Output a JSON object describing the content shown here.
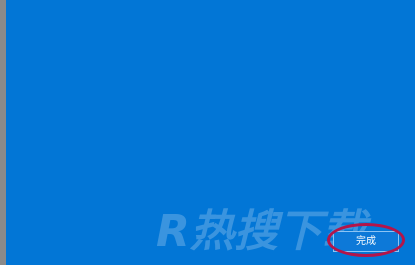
{
  "colors": {
    "panel_background": "#0276d6",
    "screen_edge": "#8a8a8a",
    "button_border": "#8cc4f4",
    "highlight_ring": "#b3154a"
  },
  "watermark": {
    "text": "R热搜下载"
  },
  "footer": {
    "done_label": "完成"
  }
}
